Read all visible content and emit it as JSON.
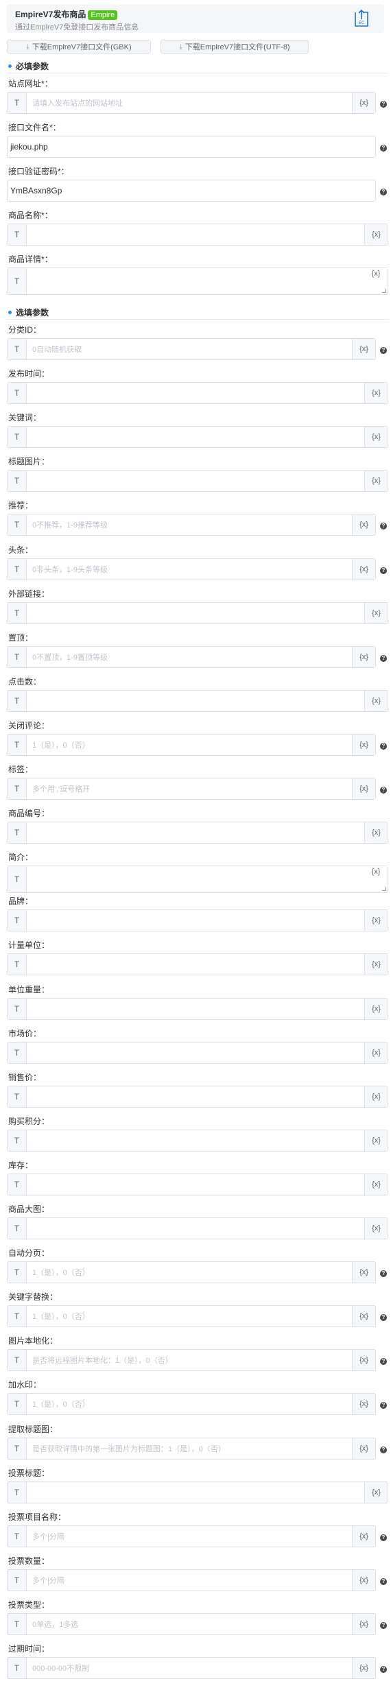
{
  "header": {
    "title": "EmpireV7发布商品",
    "badge": "Empire",
    "subtitle": "通过EmpireV7免登接口发布商品信息",
    "logo_text": "EC"
  },
  "downloads": {
    "gbk_label": "下载EmpireV7接口文件(GBK)",
    "utf8_label": "下载EmpireV7接口文件(UTF-8)",
    "icon": "download-icon"
  },
  "sections": {
    "required": "必填参数",
    "optional": "选填参数"
  },
  "common": {
    "type_label": "T",
    "var_label": "{x}",
    "help_label": "?"
  },
  "required_fields": [
    {
      "label": "站点网址*：",
      "placeholder": "请填入发布站点的网站地址",
      "value": ""
    },
    {
      "label": "接口文件名*：",
      "placeholder": "",
      "value": "jiekou.php"
    },
    {
      "label": "接口验证密码*：",
      "placeholder": "",
      "value": "YmBAsxn8Gp"
    },
    {
      "label": "商品名称*：",
      "placeholder": "",
      "value": ""
    },
    {
      "label": "商品详情*：",
      "placeholder": "",
      "value": ""
    }
  ],
  "optional_fields": [
    {
      "label": "分类ID：",
      "placeholder": "0自动随机获取"
    },
    {
      "label": "发布时间：",
      "placeholder": ""
    },
    {
      "label": "关键词：",
      "placeholder": ""
    },
    {
      "label": "标题图片：",
      "placeholder": ""
    },
    {
      "label": "推荐：",
      "placeholder": "0不推荐，1-9推荐等级"
    },
    {
      "label": "头条：",
      "placeholder": "0非头条，1-9头条等级"
    },
    {
      "label": "外部链接：",
      "placeholder": ""
    },
    {
      "label": "置顶：",
      "placeholder": "0不置顶，1-9置顶等级"
    },
    {
      "label": "点击数：",
      "placeholder": ""
    },
    {
      "label": "关闭评论：",
      "placeholder": "1（是），0（否）"
    },
    {
      "label": "标签：",
      "placeholder": "多个用','逗号格开"
    },
    {
      "label": "商品编号：",
      "placeholder": ""
    },
    {
      "label": "简介：",
      "placeholder": ""
    },
    {
      "label": "品牌：",
      "placeholder": ""
    },
    {
      "label": "计量单位：",
      "placeholder": ""
    },
    {
      "label": "单位重量：",
      "placeholder": ""
    },
    {
      "label": "市场价：",
      "placeholder": ""
    },
    {
      "label": "销售价：",
      "placeholder": ""
    },
    {
      "label": "购买积分：",
      "placeholder": ""
    },
    {
      "label": "库存：",
      "placeholder": ""
    },
    {
      "label": "商品大图：",
      "placeholder": ""
    },
    {
      "label": "自动分页：",
      "placeholder": "1（是），0（否）"
    },
    {
      "label": "关键字替换：",
      "placeholder": "1（是），0（否）"
    },
    {
      "label": "图片本地化：",
      "placeholder": "是否将远程图片本地化：1（是），0（否）"
    },
    {
      "label": "加水印：",
      "placeholder": "1（是），0（否）"
    },
    {
      "label": "提取标题图：",
      "placeholder": "是否获取详情中的第一张图片为标题图：1（是），0（否）"
    },
    {
      "label": "投票标题：",
      "placeholder": ""
    },
    {
      "label": "投票项目名称：",
      "placeholder": "多个|分隔"
    },
    {
      "label": "投票数量：",
      "placeholder": "多个|分隔"
    },
    {
      "label": "投票类型：",
      "placeholder": "0单选，1多选"
    },
    {
      "label": "过期时间：",
      "placeholder": "000-00-00不限制"
    }
  ]
}
